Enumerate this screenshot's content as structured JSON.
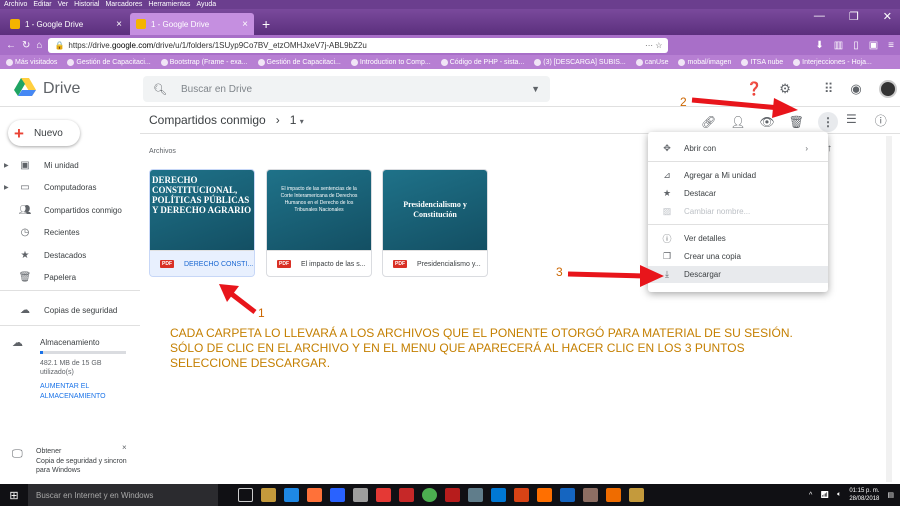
{
  "browser": {
    "menu": [
      "Archivo",
      "Editar",
      "Ver",
      "Historial",
      "Marcadores",
      "Herramientas",
      "Ayuda"
    ],
    "tabs": [
      {
        "label": "1 - Google Drive"
      },
      {
        "label": "1 - Google Drive"
      }
    ],
    "url_prefix": "https://drive.",
    "url_domain": "google.com",
    "url_rest": "/drive/u/1/folders/1SUyp9Co7BV_etzOMHJxeV7j-ABL9bZ2u",
    "bookmarks": [
      "Más visitados",
      "Gestión de Capacitaci...",
      "Bootstrap (Frame - exa...",
      "Gestión de Capacitaci...",
      "Introduction to Comp...",
      "Código de PHP - sista...",
      "(3) [DESCARGA] SUBIS...",
      "canUse",
      "mobal/imagen",
      "ITSA nube",
      "Interjecciones - Hoja..."
    ]
  },
  "header": {
    "app_name": "Drive",
    "search_placeholder": "Buscar en Drive"
  },
  "breadcrumb": {
    "parent": "Compartidos conmigo",
    "current": "1"
  },
  "sidebar": {
    "new_label": "Nuevo",
    "items": [
      {
        "label": "Mi unidad"
      },
      {
        "label": "Computadoras"
      },
      {
        "label": "Compartidos conmigo"
      },
      {
        "label": "Recientes"
      },
      {
        "label": "Destacados"
      },
      {
        "label": "Papelera"
      },
      {
        "label": "Copias de seguridad"
      }
    ],
    "storage_title": "Almacenamiento",
    "storage_used_fraction": 0.03,
    "storage_text": "482.1 MB de 15 GB utilizado(s)",
    "upgrade": "AUMENTAR EL ALMACENAMIENTO",
    "obtain_title": "Obtener",
    "obtain_text": "Copia de seguridad y sincron para Windows"
  },
  "content": {
    "section": "Archivos",
    "files": [
      {
        "name": "DERECHO CONSTI...",
        "thumb": "DERECHO CONSTITUCIONAL, POLÍTICAS PÚBLICAS Y DERECHO AGRARIO",
        "type": "PDF"
      },
      {
        "name": "El impacto de las s...",
        "thumb": "El impacto de las sentencias de la Corte Interamericana de Derechos Humanos en el Derecho de los Tribunales Nacionales",
        "type": "PDF"
      },
      {
        "name": "Presidencialismo y...",
        "thumb": "Presidencialismo y Constitución",
        "type": "PDF"
      }
    ]
  },
  "menu": {
    "items": [
      {
        "label": "Abrir con",
        "icon": "open-with-icon"
      },
      {
        "label": "Agregar a Mi unidad",
        "icon": "add-drive-icon"
      },
      {
        "label": "Destacar",
        "icon": "star-icon"
      },
      {
        "label": "Cambiar nombre...",
        "icon": "rename-icon"
      },
      {
        "label": "Ver detalles",
        "icon": "info-icon"
      },
      {
        "label": "Crear una copia",
        "icon": "copy-icon"
      },
      {
        "label": "Descargar",
        "icon": "download-icon"
      }
    ]
  },
  "annotations": {
    "n1": "1",
    "n2": "2",
    "n3": "3",
    "note": "CADA CARPETA LO LLEVARÁ A LOS ARCHIVOS QUE EL PONENTE OTORGÓ PARA MATERIAL DE SU SESIÓN. SÓLO DE CLIC EN EL ARCHIVO Y EN EL MENU QUE APARECERÁ AL HACER CLIC EN LOS 3 PUNTOS SELECCIONE DESCARGAR."
  },
  "taskbar": {
    "search": "Buscar en Internet y en Windows",
    "time": "01:15 p. m.",
    "date": "28/08/2018"
  },
  "colors": {
    "accent": "#1a73e8",
    "arrow": "#e8151b",
    "note": "#c47f00"
  }
}
